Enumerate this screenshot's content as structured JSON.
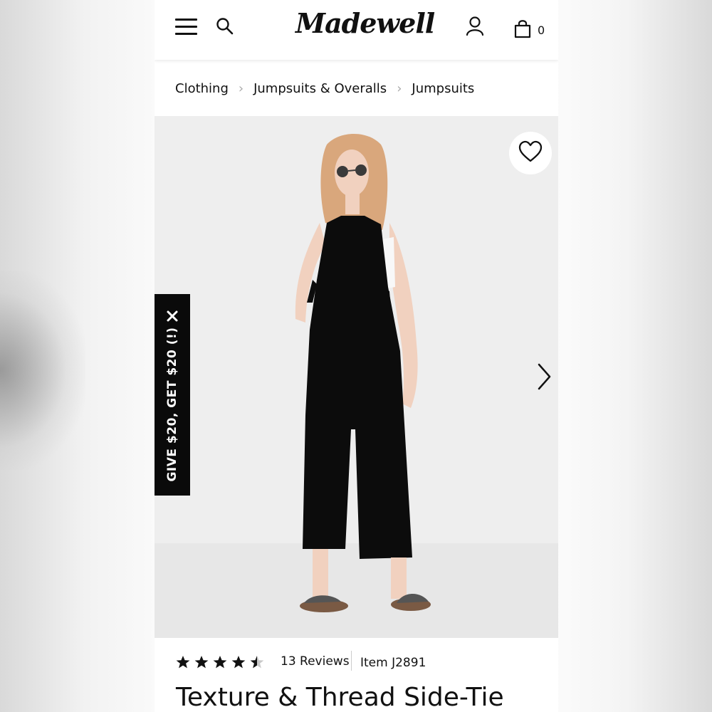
{
  "header": {
    "logo_text": "Madewell",
    "bag_count": "0",
    "icons": [
      "menu-icon",
      "search-icon",
      "account-icon",
      "shopping-bag-icon"
    ]
  },
  "breadcrumb": {
    "items": [
      "Clothing",
      "Jumpsuits & Overalls",
      "Jumpsuits"
    ],
    "separator": "›"
  },
  "promo": {
    "text": "GIVE $20, GET $20 (!)",
    "close_icon": "close-icon"
  },
  "product": {
    "rating": 4.5,
    "rating_max": 5,
    "reviews_label": "13 Reviews",
    "item_label": "Item J2891",
    "title": "Texture & Thread Side-Tie"
  },
  "colors": {
    "text": "#111111",
    "promo_bg": "#0a0a0a",
    "photo_bg": "#eeeeee"
  }
}
